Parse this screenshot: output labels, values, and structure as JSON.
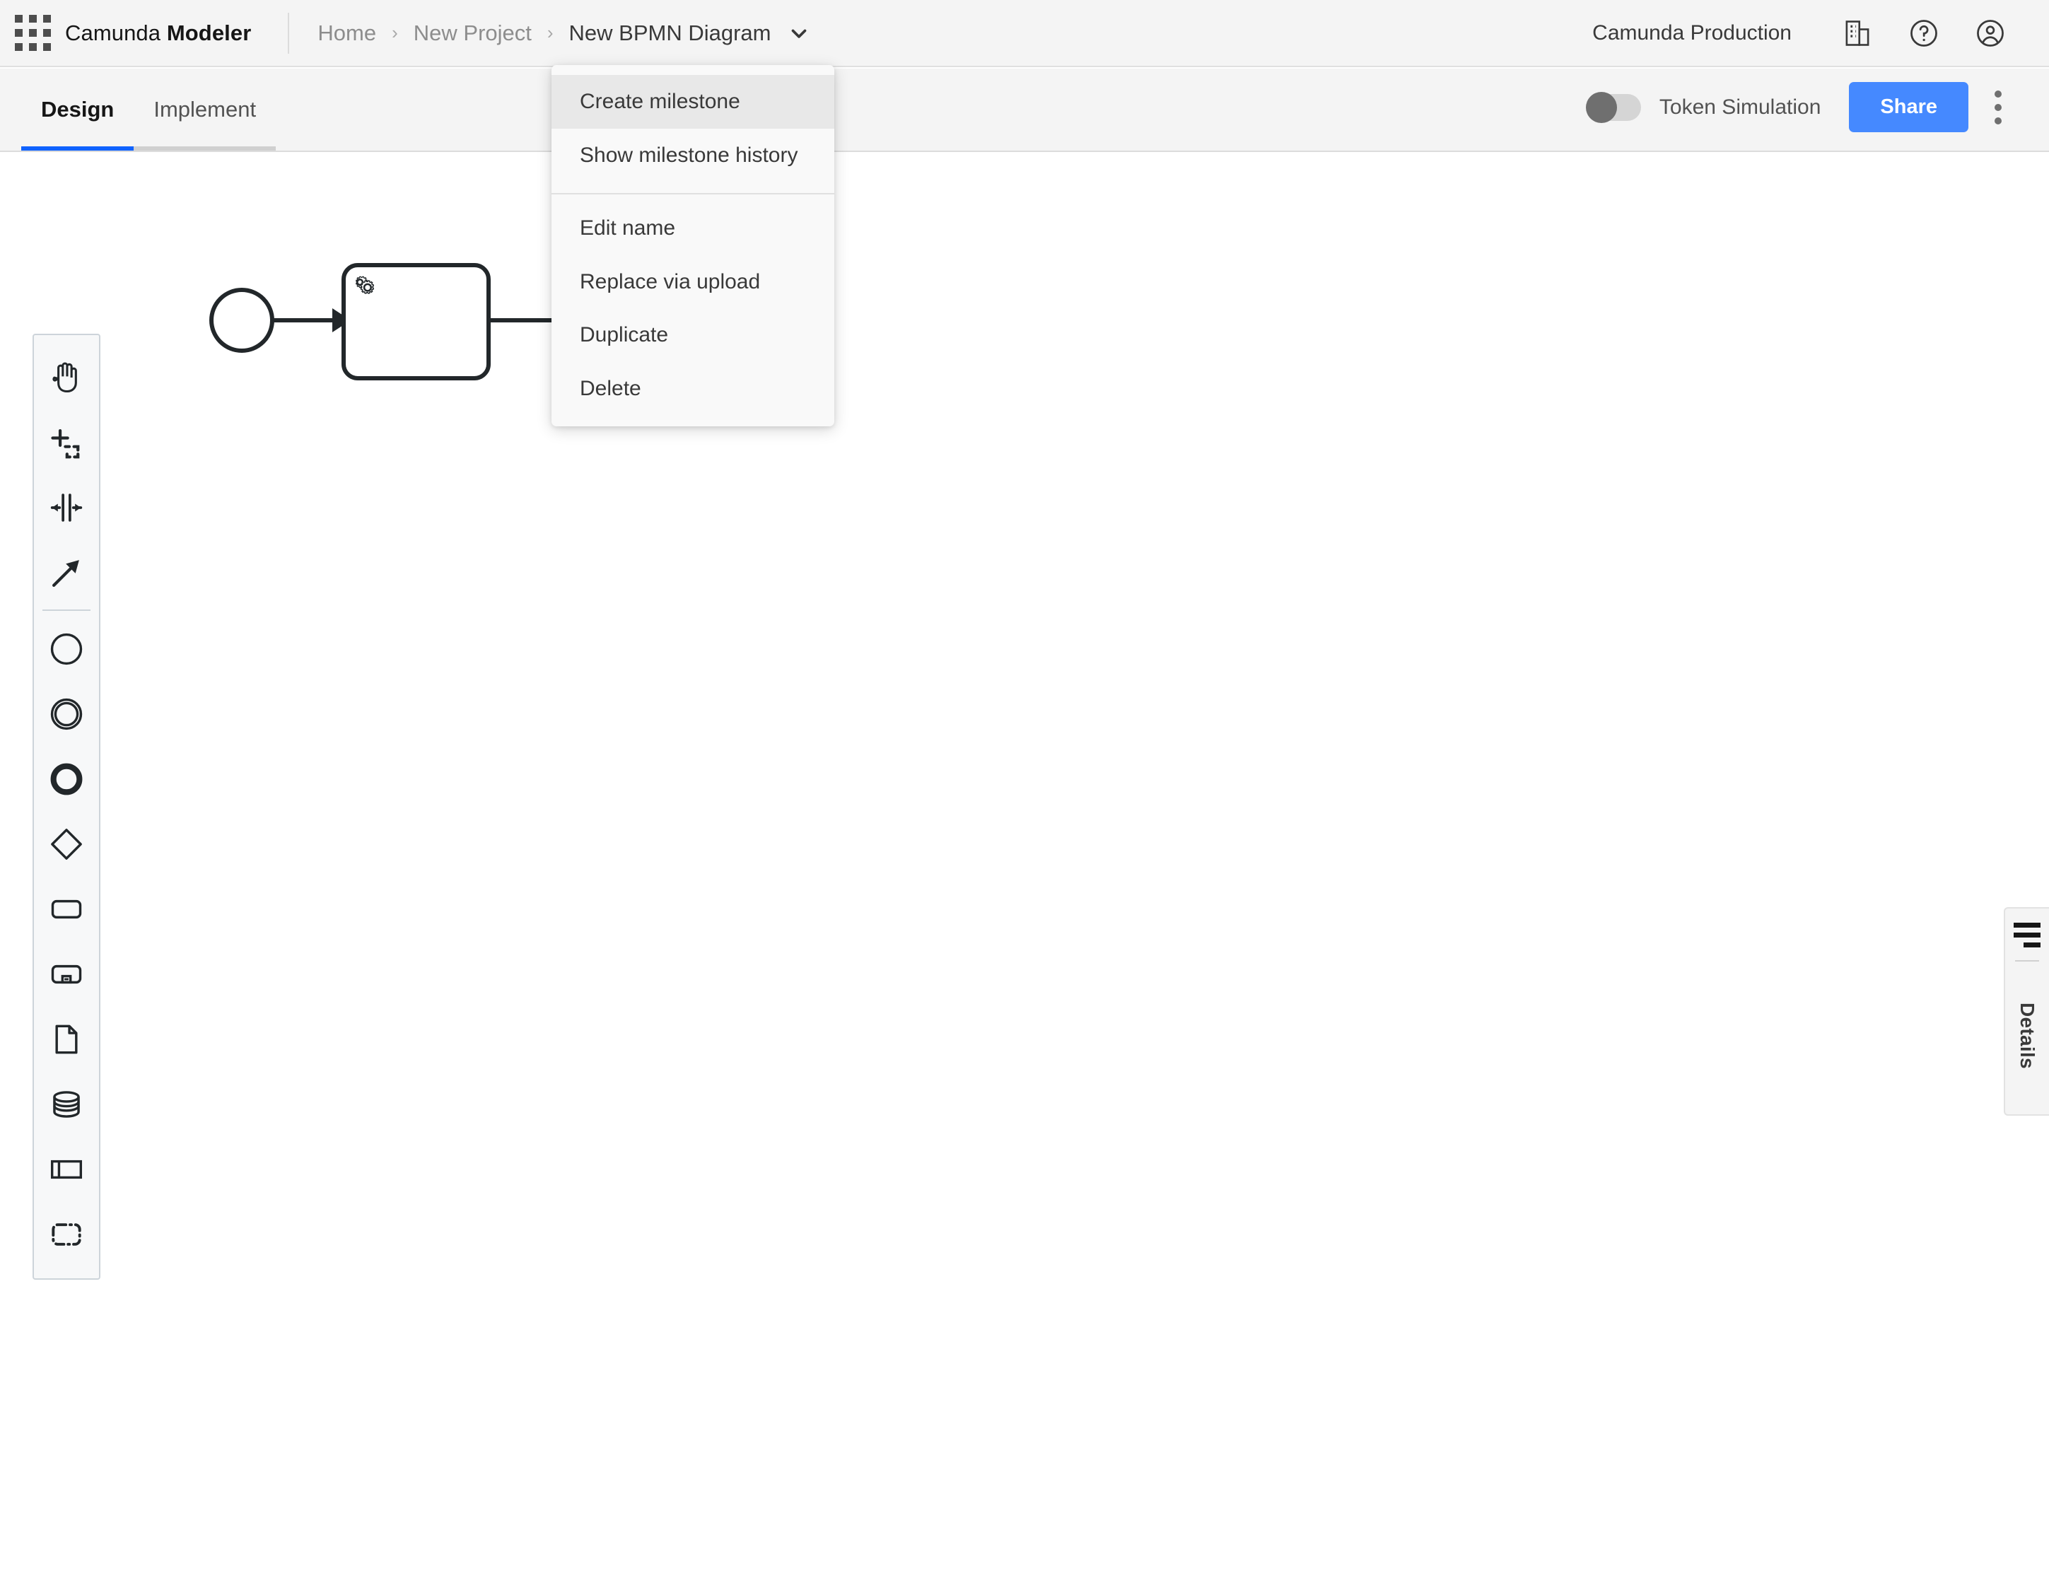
{
  "header": {
    "apps_icon": "grid-apps-icon",
    "brand_prefix": "Camunda ",
    "brand_suffix": "Modeler",
    "breadcrumb": {
      "separator": "›",
      "items": [
        {
          "label": "Home",
          "current": false
        },
        {
          "label": "New Project",
          "current": false
        },
        {
          "label": "New BPMN Diagram",
          "current": true
        }
      ],
      "caret_icon": "chevron-down-icon"
    },
    "org_name": "Camunda Production",
    "icons": [
      {
        "name": "organization-icon"
      },
      {
        "name": "help-icon"
      },
      {
        "name": "user-account-icon"
      }
    ]
  },
  "toolbar": {
    "tabs": [
      {
        "label": "Design",
        "active": true
      },
      {
        "label": "Implement",
        "active": false
      }
    ],
    "token_simulation": {
      "label": "Token Simulation",
      "enabled": false
    },
    "share_label": "Share",
    "overflow_icon": "kebab-menu-icon",
    "accent_color": "#0f62fe",
    "share_color": "#4589ff"
  },
  "palette": {
    "items": [
      {
        "name": "hand-tool-icon",
        "label": "Activate hand tool"
      },
      {
        "name": "lasso-tool-icon",
        "label": "Activate lasso tool"
      },
      {
        "name": "space-tool-icon",
        "label": "Activate create/remove space tool"
      },
      {
        "name": "connect-tool-icon",
        "label": "Activate global connect tool"
      },
      {
        "name": "start-event-icon",
        "label": "Create start event"
      },
      {
        "name": "intermediate-event-icon",
        "label": "Create intermediate/boundary event"
      },
      {
        "name": "end-event-icon",
        "label": "Create end event"
      },
      {
        "name": "gateway-icon",
        "label": "Create gateway"
      },
      {
        "name": "task-icon",
        "label": "Create task"
      },
      {
        "name": "subprocess-icon",
        "label": "Create expanded subprocess"
      },
      {
        "name": "data-object-icon",
        "label": "Create data object reference"
      },
      {
        "name": "data-store-icon",
        "label": "Create data store reference"
      },
      {
        "name": "participant-icon",
        "label": "Create pool/participant"
      },
      {
        "name": "group-icon",
        "label": "Create group"
      }
    ],
    "separator_after_index": 3
  },
  "canvas": {
    "elements": [
      {
        "name": "start-event",
        "type": "start-event"
      },
      {
        "name": "sequence-flow-1",
        "type": "sequence-flow"
      },
      {
        "name": "service-task",
        "type": "service-task",
        "marker": "gear-icon"
      },
      {
        "name": "sequence-flow-2",
        "type": "sequence-flow"
      }
    ]
  },
  "context_menu": {
    "groups": [
      {
        "items": [
          {
            "label": "Create milestone",
            "hover": true
          },
          {
            "label": "Show milestone history",
            "hover": false
          }
        ]
      },
      {
        "items": [
          {
            "label": "Edit name",
            "hover": false
          },
          {
            "label": "Replace via upload",
            "hover": false
          },
          {
            "label": "Duplicate",
            "hover": false
          },
          {
            "label": "Delete",
            "hover": false
          }
        ]
      }
    ]
  },
  "details_panel": {
    "icon": "panel-lines-icon",
    "label": "Details"
  }
}
